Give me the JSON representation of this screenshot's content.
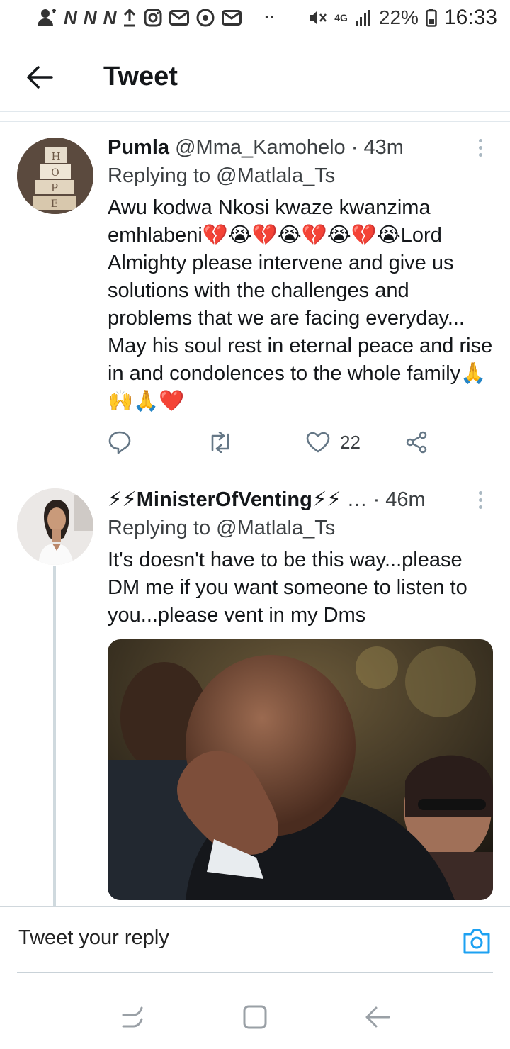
{
  "status_bar": {
    "battery": "22%",
    "time": "16:33",
    "network": "4G"
  },
  "header": {
    "title": "Tweet"
  },
  "tweets": [
    {
      "name": "Pumla",
      "handle": "@Mma_Kamohelo",
      "time": "· 43m",
      "reply_to": "Replying to @Matlala_Ts",
      "text": "Awu kodwa Nkosi kwaze kwanzima emhlabeni💔😭💔😭💔😭💔😭Lord Almighty please intervene and give us solutions with the challenges and problems that we are facing everyday... May his soul rest in eternal peace and rise in and condolences to the whole family🙏🙌🙏❤️",
      "likes": "22",
      "avatar_text": [
        "H",
        "O",
        "P",
        "E"
      ]
    },
    {
      "name": "⚡⚡MinisterOfVenting⚡⚡",
      "handle": "…",
      "time": "· 46m",
      "reply_to": "Replying to @Matlala_Ts",
      "text": "It's doesn't have to be this way...please DM me if you want someone to listen to you...please vent in my Dms"
    }
  ],
  "reply_bar": {
    "placeholder": "Tweet your reply"
  },
  "colors": {
    "accent": "#1da1f2",
    "icon_gray": "#657786",
    "divider": "#e1e8ed"
  }
}
